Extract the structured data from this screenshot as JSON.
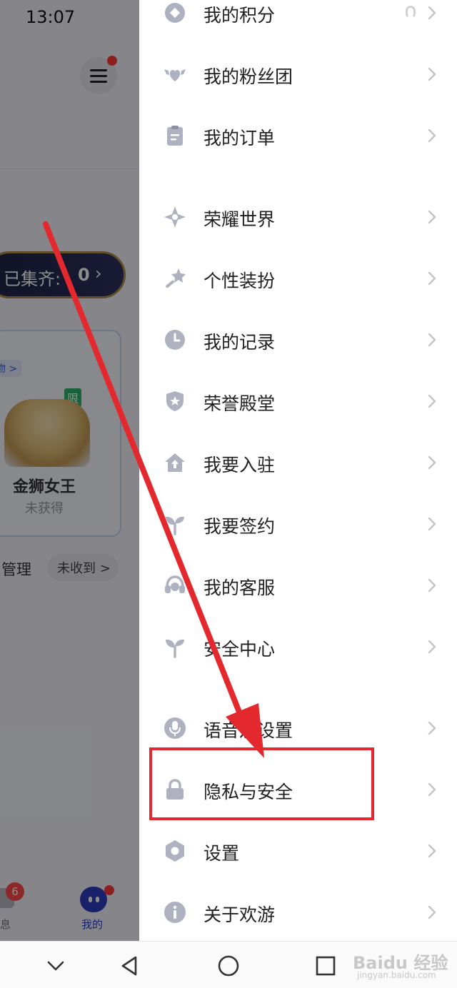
{
  "status_bar": {
    "time": "13:07"
  },
  "background": {
    "collected_label": "已集齐:",
    "collected_count": "0",
    "card_tag": "物 >",
    "card_limited": "限",
    "card_name": "金狮女王",
    "card_status": "未获得",
    "manage": "管理",
    "unreceived": "未收到 >",
    "nav_msg_badge": "6",
    "nav_msg_label": "息",
    "nav_me_label": "我的"
  },
  "drawer": {
    "items": [
      {
        "label": "我的积分",
        "icon": "diamond-icon"
      },
      {
        "label": "我的粉丝团",
        "icon": "heart-wings-icon"
      },
      {
        "label": "我的订单",
        "icon": "clipboard-icon"
      },
      {
        "label": "荣耀世界",
        "icon": "compass-star-icon"
      },
      {
        "label": "个性装扮",
        "icon": "magic-wand-icon"
      },
      {
        "label": "我的记录",
        "icon": "clock-icon"
      },
      {
        "label": "荣誉殿堂",
        "icon": "shield-star-icon"
      },
      {
        "label": "我要入驻",
        "icon": "house-up-icon"
      },
      {
        "label": "我要签约",
        "icon": "sprout-icon"
      },
      {
        "label": "我的客服",
        "icon": "headset-icon"
      },
      {
        "label": "安全中心",
        "icon": "sprout-icon"
      },
      {
        "label": "语音及设置",
        "icon": "microphone-icon"
      },
      {
        "label": "隐私与安全",
        "icon": "lock-icon"
      },
      {
        "label": "设置",
        "icon": "gear-icon"
      },
      {
        "label": "关于欢游",
        "icon": "info-icon"
      }
    ]
  },
  "watermark": {
    "text": "Baidu 经验",
    "sub": "jingyan.baidu.com"
  },
  "colors": {
    "icon": "#aeb1bf",
    "highlight": "#e3282e",
    "accent": "#2f3cc2"
  }
}
